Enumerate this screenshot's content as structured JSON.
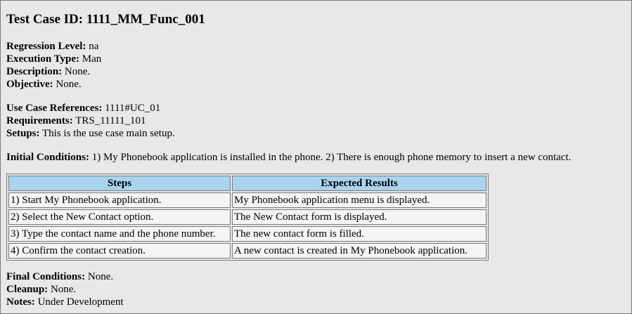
{
  "title": "Test Case ID: 1111_MM_Func_001",
  "regression_level": {
    "label": "Regression Level:",
    "value": "na"
  },
  "execution_type": {
    "label": "Execution Type:",
    "value": "Man"
  },
  "description": {
    "label": "Description:",
    "value": "None."
  },
  "objective": {
    "label": "Objective:",
    "value": "None."
  },
  "use_case_refs": {
    "label": "Use Case References:",
    "value": "1111#UC_01"
  },
  "requirements": {
    "label": "Requirements:",
    "value": "TRS_11111_101"
  },
  "setups": {
    "label": "Setups:",
    "value": "This is the use case main setup."
  },
  "initial_conditions": {
    "label": "Initial Conditions:",
    "value": "1) My Phonebook application is installed in the phone. 2) There is enough phone memory to insert a new contact."
  },
  "table": {
    "headers": [
      "Steps",
      "Expected Results"
    ],
    "rows": [
      [
        "1) Start My Phonebook application.",
        "My Phonebook application menu is displayed."
      ],
      [
        "2) Select the New Contact option.",
        "The New Contact form is displayed."
      ],
      [
        "3) Type the contact name and the phone number.",
        "The new contact form is filled."
      ],
      [
        "4) Confirm the contact creation.",
        "A new contact is created in My Phonebook application."
      ]
    ]
  },
  "final_conditions": {
    "label": "Final Conditions:",
    "value": "None."
  },
  "cleanup": {
    "label": "Cleanup:",
    "value": "None."
  },
  "notes": {
    "label": "Notes:",
    "value": "Under Development"
  },
  "colors": {
    "background": "#e8e8e8",
    "header_fill": "#a8d4ef",
    "border": "#7a7a7a"
  }
}
